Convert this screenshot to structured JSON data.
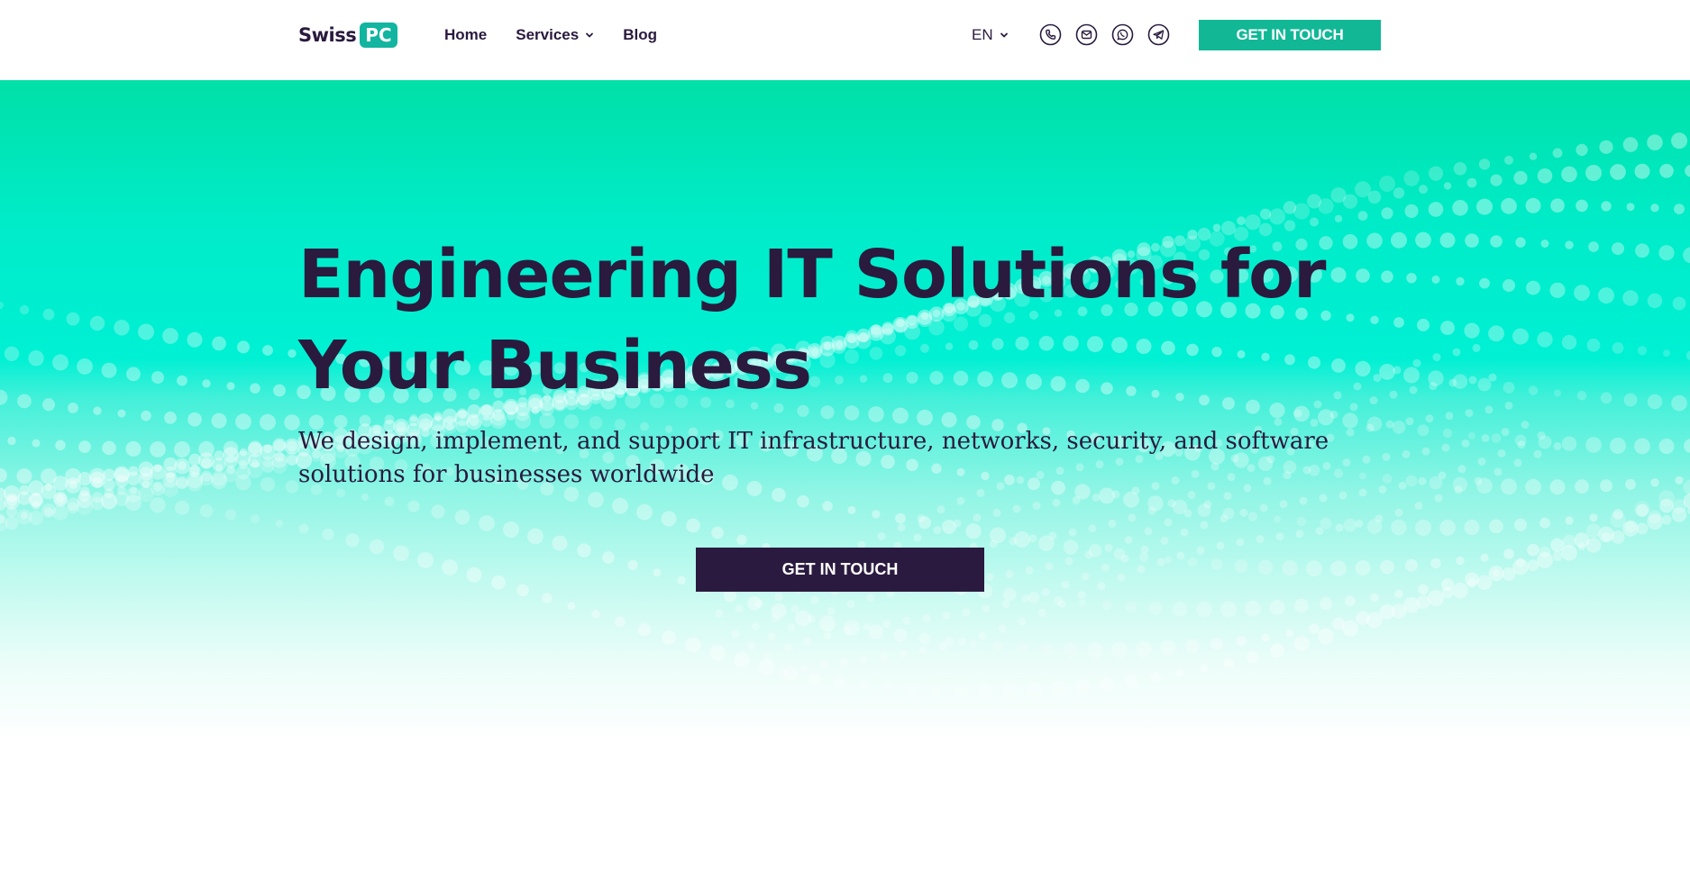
{
  "brand": {
    "name": "Swiss",
    "badge": "PC",
    "badge_color": "#12b5a0"
  },
  "nav": {
    "items": [
      {
        "label": "Home"
      },
      {
        "label": "Services"
      },
      {
        "label": "Blog"
      }
    ]
  },
  "language": {
    "selected": "EN"
  },
  "contact_icons": [
    "phone-icon",
    "mail-icon",
    "whatsapp-icon",
    "telegram-icon"
  ],
  "header_cta": {
    "label": "GET IN TOUCH"
  },
  "hero": {
    "title_line1": "Engineering IT Solutions for",
    "title_line2": "Your Business",
    "subtitle": "We design, implement, and support IT infrastructure, networks, security, and software solutions for businesses worldwide",
    "cta_label": "GET IN TOUCH"
  },
  "colors": {
    "accent": "#12b896",
    "hero_top": "#00e0a8",
    "hero_mid": "#00f0d4",
    "text_dark": "#2a1a3e",
    "cta_dark": "#2b1a3f"
  }
}
